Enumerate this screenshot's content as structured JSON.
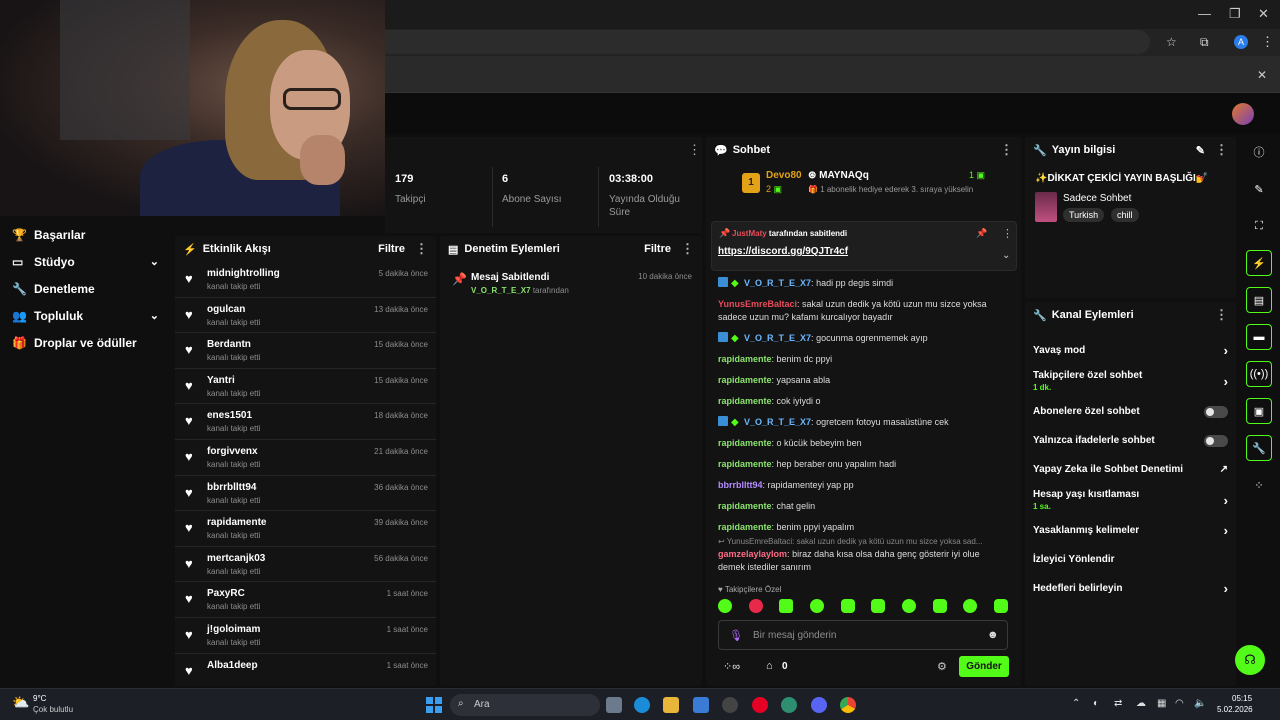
{
  "stats": [
    {
      "value": "179",
      "label": "Takipçi"
    },
    {
      "value": "6",
      "label": "Abone Sayısı"
    },
    {
      "value": "03:38:00",
      "label": "Yayında Olduğu Süre"
    }
  ],
  "nav": {
    "items": [
      {
        "label": "Başarılar"
      },
      {
        "label": "Stüdyo"
      },
      {
        "label": "Denetleme"
      },
      {
        "label": "Topluluk"
      },
      {
        "label": "Droplar ve ödüller"
      }
    ]
  },
  "feed": {
    "title": "Etkinlik Akışı",
    "filter": "Filtre",
    "rows": [
      {
        "name": "midnightrolling",
        "sub": "kanalı takip etti",
        "time": "5 dakika önce"
      },
      {
        "name": "ogulcan",
        "sub": "kanalı takip etti",
        "time": "13 dakika önce"
      },
      {
        "name": "Berdantn",
        "sub": "kanalı takip etti",
        "time": "15 dakika önce"
      },
      {
        "name": "Yantri",
        "sub": "kanalı takip etti",
        "time": "15 dakika önce"
      },
      {
        "name": "enes1501",
        "sub": "kanalı takip etti",
        "time": "18 dakika önce"
      },
      {
        "name": "forgivvenx",
        "sub": "kanalı takip etti",
        "time": "21 dakika önce"
      },
      {
        "name": "bbrrblltt94",
        "sub": "kanalı takip etti",
        "time": "36 dakika önce"
      },
      {
        "name": "rapidamente",
        "sub": "kanalı takip etti",
        "time": "39 dakika önce"
      },
      {
        "name": "mertcanjk03",
        "sub": "kanalı takip etti",
        "time": "56 dakika önce"
      },
      {
        "name": "PaxyRC",
        "sub": "kanalı takip etti",
        "time": "1 saat önce"
      },
      {
        "name": "j!goloimam",
        "sub": "kanalı takip etti",
        "time": "1 saat önce"
      },
      {
        "name": "Alba1deep",
        "sub": "",
        "time": "1 saat önce"
      }
    ]
  },
  "mod": {
    "title": "Denetim Eylemleri",
    "filter": "Filtre",
    "entry": {
      "title": "Mesaj Sabitlendi",
      "user": "V_O_R_T_E_X7",
      "by": "tarafından",
      "time": "10 dakika önce"
    }
  },
  "chat": {
    "title": "Sohbet",
    "leader": {
      "rank": "1",
      "name": "Devo80",
      "count": "2",
      "name2": "MAYNAQq",
      "count2": "1",
      "note": "1 abonelik hediye ederek 3. sıraya yükselin"
    },
    "pinned": {
      "user": "JustMaty",
      "by": "tarafından sabitlendi",
      "link": "https://discord.gg/9QJTr4cf"
    },
    "messages": [
      {
        "user": "V_O_R_T_E_X7",
        "cls": "u-blue",
        "badge": true,
        "text": "hadi pp degis simdi"
      },
      {
        "user": "YunusEmreBaltaci",
        "cls": "u-red",
        "badge": false,
        "text": "sakal uzun dedik ya kötü uzun mu sizce yoksa sadece uzun mu? kafamı kurcalıyor bayadır"
      },
      {
        "user": "V_O_R_T_E_X7",
        "cls": "u-blue",
        "badge": true,
        "text": "gocunma ogrenmemek ayıp"
      },
      {
        "user": "rapidamente",
        "cls": "u-green",
        "badge": false,
        "text": "benim dc ppyi"
      },
      {
        "user": "rapidamente",
        "cls": "u-green",
        "badge": false,
        "text": "yapsana abla"
      },
      {
        "user": "rapidamente",
        "cls": "u-green",
        "badge": false,
        "text": "cok iyiydi o"
      },
      {
        "user": "V_O_R_T_E_X7",
        "cls": "u-blue",
        "badge": true,
        "text": "ogretcem fotoyu masaüstüne cek"
      },
      {
        "user": "rapidamente",
        "cls": "u-green",
        "badge": false,
        "text": "o kücük bebeyim ben"
      },
      {
        "user": "rapidamente",
        "cls": "u-green",
        "badge": false,
        "text": "hep beraber onu yapalım hadi"
      },
      {
        "user": "bbrrblltt94",
        "cls": "u-purple",
        "badge": false,
        "text": "rapidamenteyi yap pp"
      },
      {
        "user": "rapidamente",
        "cls": "u-green",
        "badge": false,
        "text": "chat gelin"
      },
      {
        "user": "rapidamente",
        "cls": "u-green",
        "badge": false,
        "text": "benim ppyi yapalım"
      }
    ],
    "reply_ref": "YunusEmreBaltaci: sakal uzun dedik ya kötü uzun mu sizce yoksa sad...",
    "reply": {
      "user": "gamzelaylaylom",
      "text": "biraz daha kısa olsa daha genç gösterir iyi olue demek istediler sanırım"
    },
    "followers_only": "Takipçilere Özel",
    "placeholder": "Bir mesaj gönderin",
    "points": "0",
    "send": "Gönder"
  },
  "streaminfo": {
    "title": "Yayın bilgisi",
    "stream_title": "✨DİKKAT ÇEKİCİ YAYIN BAŞLIĞI💅",
    "category": "Sadece Sohbet",
    "tags": [
      "Turkish",
      "chill"
    ]
  },
  "channel": {
    "title": "Kanal Eylemleri",
    "rows": [
      {
        "label": "Yavaş mod",
        "sub": "",
        "ctrl": "chev"
      },
      {
        "label": "Takipçilere özel sohbet",
        "sub": "1 dk.",
        "ctrl": "chev"
      },
      {
        "label": "Abonelere özel sohbet",
        "sub": "",
        "ctrl": "toggle"
      },
      {
        "label": "Yalnızca ifadelerle sohbet",
        "sub": "",
        "ctrl": "toggle"
      },
      {
        "label": "Yapay Zeka ile Sohbet Denetimi",
        "sub": "",
        "ctrl": "ext"
      },
      {
        "label": "Hesap yaşı kısıtlaması",
        "sub": "1 sa.",
        "ctrl": "chev"
      },
      {
        "label": "Yasaklanmış kelimeler",
        "sub": "",
        "ctrl": "chev"
      },
      {
        "label": "İzleyici Yönlendir",
        "sub": "",
        "ctrl": ""
      },
      {
        "label": "Hedefleri belirleyin",
        "sub": "",
        "ctrl": "chev"
      }
    ]
  },
  "taskbar": {
    "weather_temp": "9°C",
    "weather_text": "Çok bulutlu",
    "search": "Ara",
    "time": "05:15",
    "date": "5.02.2026"
  },
  "colors": {
    "accent": "#53fc18",
    "panel": "#131313"
  }
}
